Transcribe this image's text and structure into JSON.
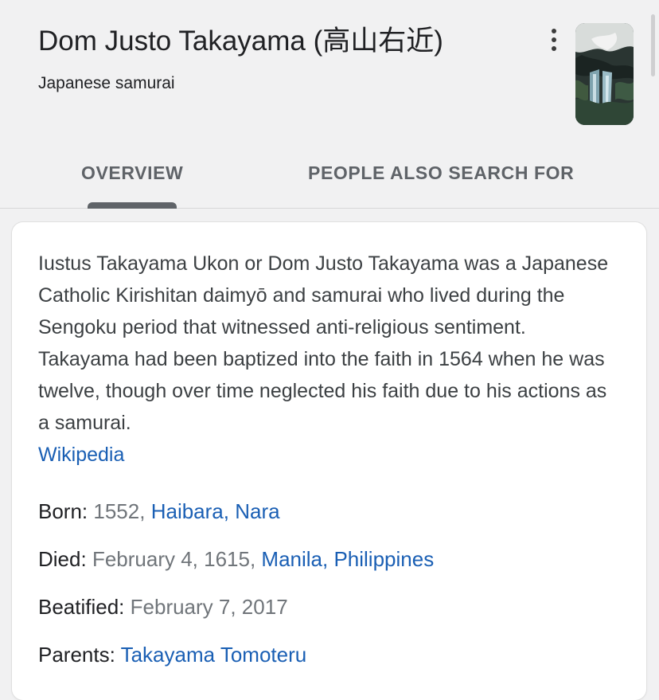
{
  "header": {
    "title": "Dom Justo Takayama (高山右近)",
    "subtitle": "Japanese samurai"
  },
  "tabs": [
    {
      "label": "OVERVIEW",
      "active": true
    },
    {
      "label": "PEOPLE ALSO SEARCH FOR",
      "active": false
    }
  ],
  "description": {
    "text": "Iustus Takayama Ukon or Dom Justo Takayama was a Japanese Catholic Kirishitan daimyō and samurai who lived during the Sengoku period that witnessed anti-religious sentiment. Takayama had been baptized into the faith in 1564 when he was twelve, though over time neglected his faith due to his actions as a samurai.",
    "source": "Wikipedia"
  },
  "facts": {
    "born": {
      "label": "Born:",
      "value": "1552,",
      "link": "Haibara, Nara"
    },
    "died": {
      "label": "Died:",
      "value": "February 4, 1615,",
      "link": "Manila, Philippines"
    },
    "beatified": {
      "label": "Beatified:",
      "value": "February 7, 2017"
    },
    "parents": {
      "label": "Parents:",
      "link": "Takayama Tomoteru"
    }
  },
  "colors": {
    "link": "#1a5fb4",
    "muted": "#70757a",
    "background": "#f1f1f2"
  }
}
